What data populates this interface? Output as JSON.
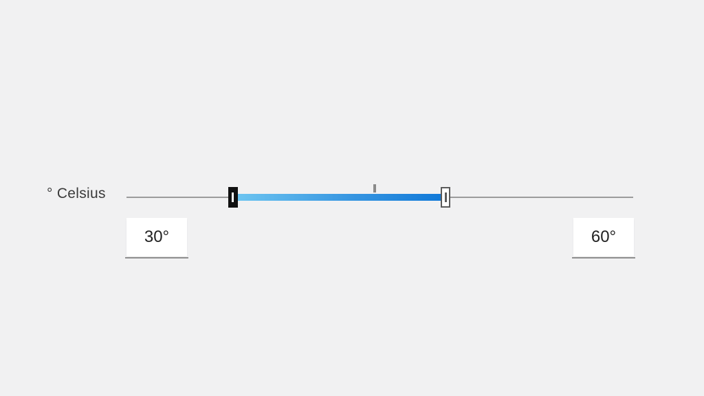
{
  "slider": {
    "unit_label": "° Celsius",
    "track_min": 20,
    "track_max": 70,
    "low_value": 30,
    "high_value": 60,
    "fill_start_pct": 21,
    "fill_end_pct": 63,
    "tick_center_pct": 49,
    "low_display": "30°",
    "high_display": "60°",
    "fill_gradient_from": "#6ec6f1",
    "fill_gradient_to": "#0f78d8"
  }
}
